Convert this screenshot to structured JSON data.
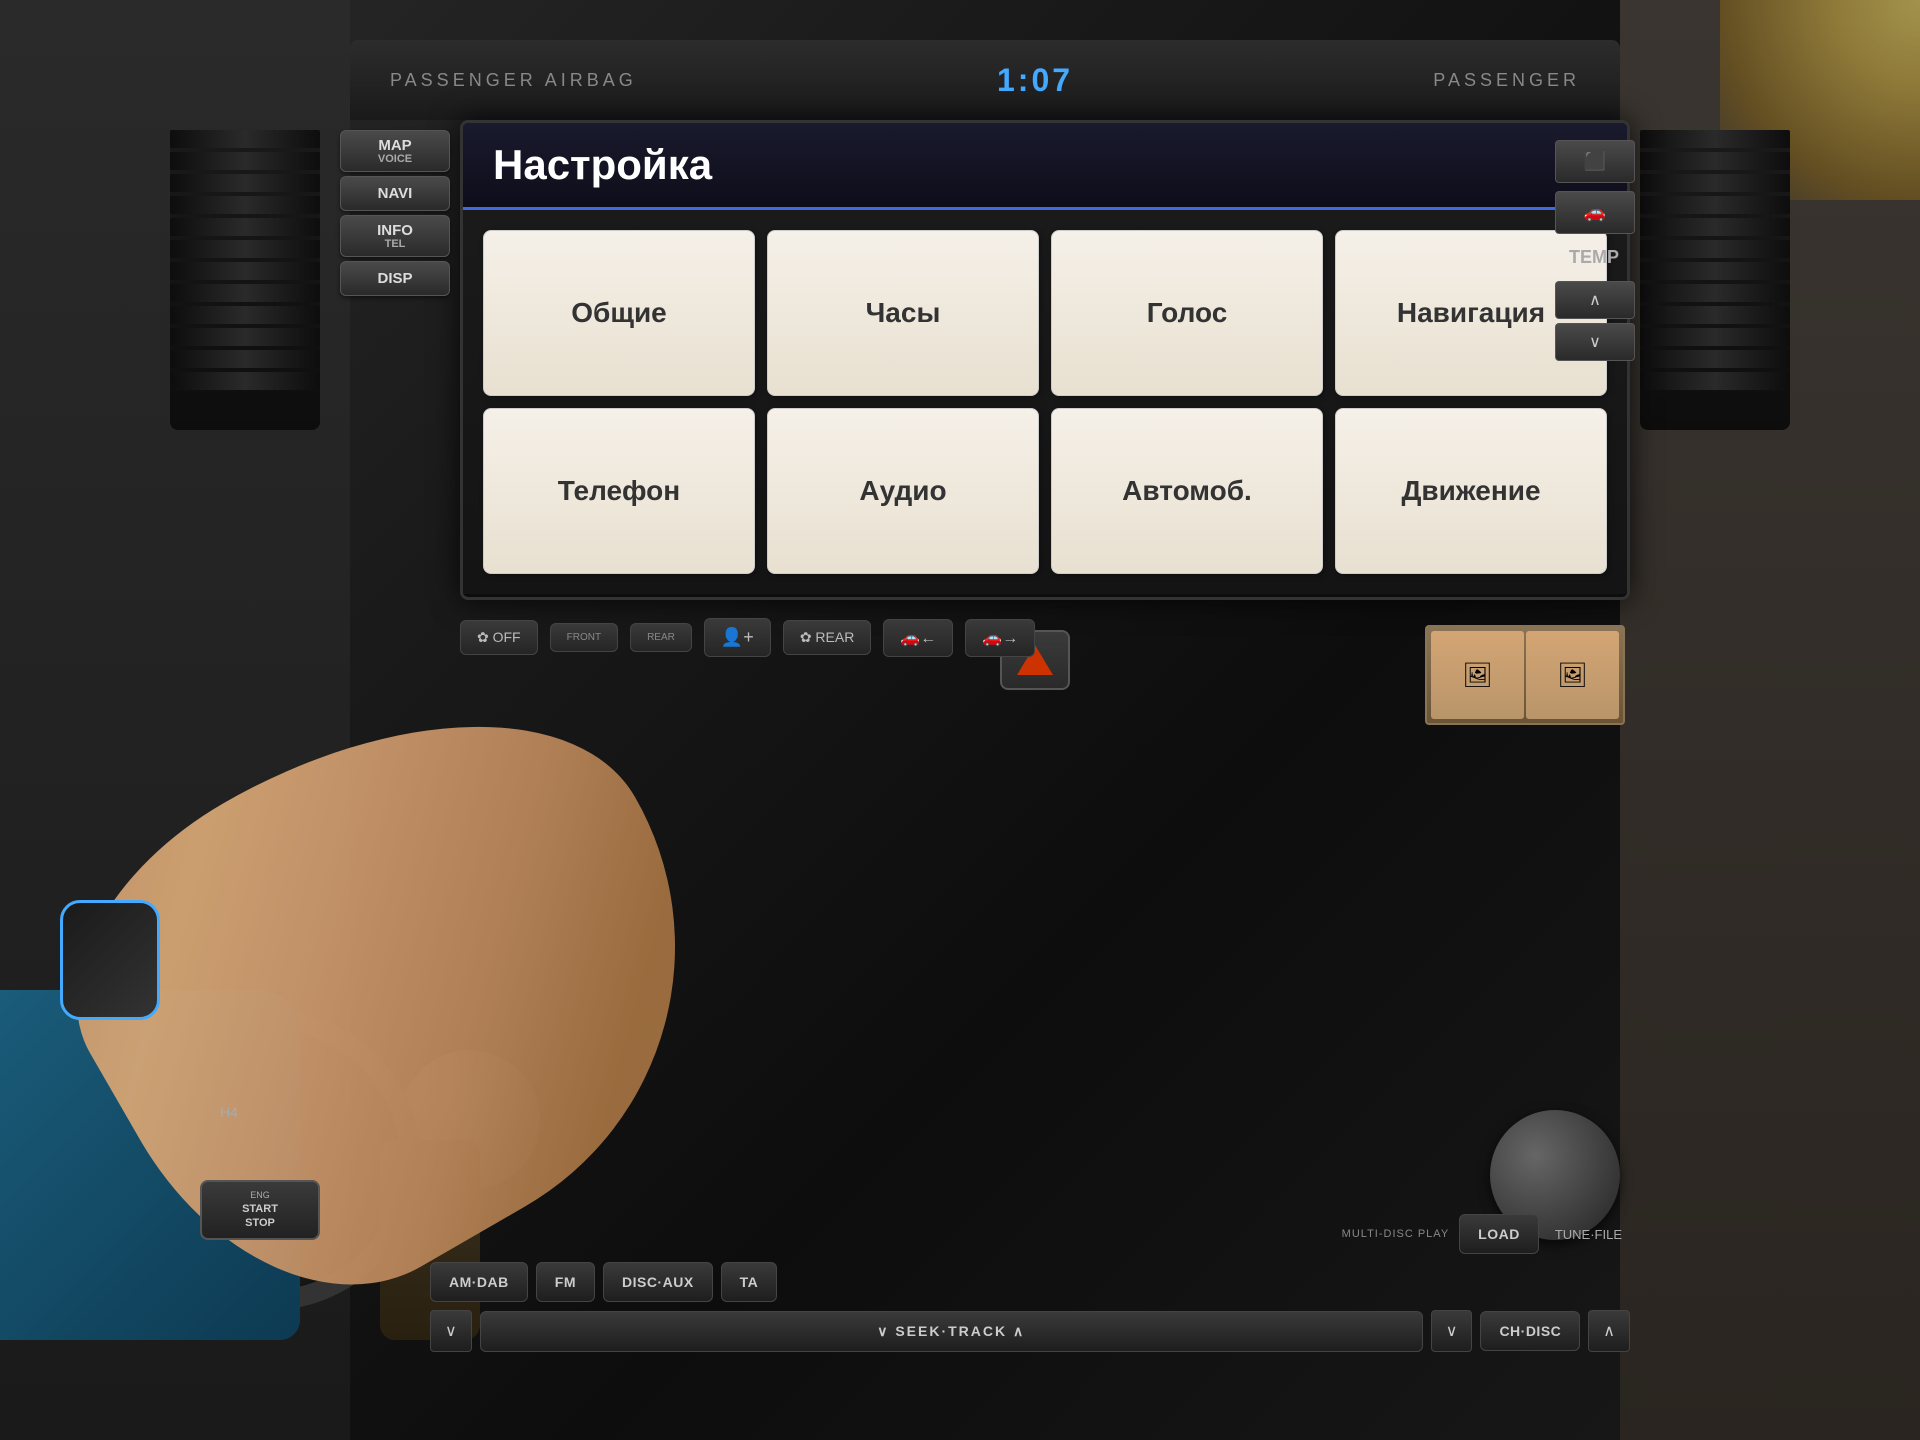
{
  "screen": {
    "title": "Настройка",
    "header_bg": "#1a1a2e",
    "accent_color": "#4169e1"
  },
  "clock": {
    "time": "1:07"
  },
  "labels": {
    "passenger_airbag_left": "PASSENGER  AIRBAG",
    "passenger_right": "PASSENGER",
    "map_voice": "MAP",
    "map_voice_sub": "VOICE",
    "navi": "NAVI",
    "info_tel": "INFO",
    "info_tel_sub": "TEL",
    "disp": "DISP",
    "temp": "TEMP",
    "temp_up": "∧",
    "temp_down": "∨",
    "fan_off": "✿ OFF",
    "front": "FRONT",
    "rear": "REAR",
    "rear_fan": "✿ REAR",
    "load": "LOAD",
    "tune_file": "TUNE·FILE",
    "multi_disc_play": "MULTI-DISC PLAY",
    "am_dab": "AM·DAB",
    "fm": "FM",
    "disc_aux": "DISC·AUX",
    "ta": "TA",
    "seek_track_down": "∨  SEEK·TRACK  ∧",
    "ch_disc_down": "∨",
    "ch_disc": "CH·DISC",
    "ch_disc_up": "∧",
    "push_start": "START\nSTOP",
    "h4": "H4"
  },
  "menu_buttons": [
    {
      "id": "obshchie",
      "label": "Общие"
    },
    {
      "id": "chasy",
      "label": "Часы"
    },
    {
      "id": "golos",
      "label": "Голос"
    },
    {
      "id": "navigatsiya",
      "label": "Навигация"
    },
    {
      "id": "telefon",
      "label": "Телефон"
    },
    {
      "id": "audio",
      "label": "Аудио"
    },
    {
      "id": "avtomob",
      "label": "Автомоб."
    },
    {
      "id": "dvizhenie",
      "label": "Движение"
    }
  ]
}
